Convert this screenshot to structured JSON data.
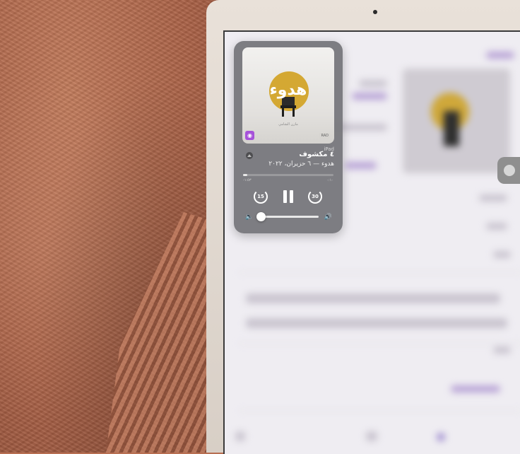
{
  "now_playing": {
    "artwork_title": "هدوء",
    "artwork_credit": "مازن الشامي",
    "corner_label": "RAD",
    "device": "iPad",
    "episode_title": "٤ مكشوف",
    "episode_subtitle": "هدوء — ٦ حزيران، ٢٠٢٢",
    "elapsed": "-١:٥٣",
    "remaining": "٠:١٠",
    "progress": 0.05,
    "skip_back_seconds": "15",
    "skip_forward_seconds": "30",
    "volume_level": 0.05
  },
  "icons": {
    "airplay": "airplay-icon",
    "podcast_badge": "podcasts-app-icon",
    "volume_low": "speaker-low-icon",
    "volume_high": "speaker-high-icon",
    "skip_back": "skip-back-15-icon",
    "skip_forward": "skip-forward-30-icon",
    "pause": "pause-icon"
  },
  "colors": {
    "widget_bg": "#76767a",
    "accent_purple": "#a652d9",
    "artwork_sun": "#d4a833"
  }
}
